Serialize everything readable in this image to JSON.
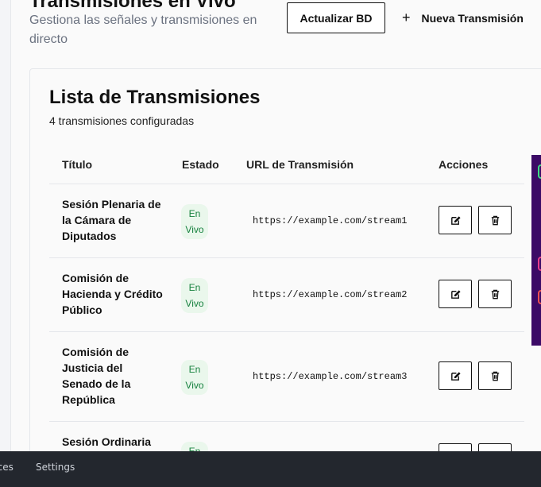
{
  "header": {
    "title": "Transmisiones en Vivo",
    "subtitle": "Gestiona las señales y transmisiones en directo",
    "refresh_label": "Actualizar BD",
    "new_label": "Nueva Transmisión"
  },
  "card": {
    "title": "Lista de Transmisiones",
    "subtitle": "4 transmisiones configuradas"
  },
  "table": {
    "columns": [
      "Título",
      "Estado",
      "URL de Transmisión",
      "Acciones"
    ],
    "rows": [
      {
        "title": "Sesión Plenaria de la Cámara de Diputados",
        "status": "En Vivo",
        "url": "https://example.com/stream1"
      },
      {
        "title": "Comisión de Hacienda y Crédito Público",
        "status": "En Vivo",
        "url": "https://example.com/stream2"
      },
      {
        "title": "Comisión de Justicia del Senado de la República",
        "status": "En Vivo",
        "url": "https://example.com/stream3"
      },
      {
        "title": "Sesión Ordinaria",
        "status": "En Vivo",
        "url": ""
      }
    ]
  },
  "bottom_bar": {
    "tabs": [
      "rces",
      "Settings"
    ]
  },
  "colors": {
    "badge_bg": "#eaf7ec",
    "badge_text": "#15803d",
    "bottom_bar": "#23272e",
    "side_panel": "#3b0a66"
  }
}
